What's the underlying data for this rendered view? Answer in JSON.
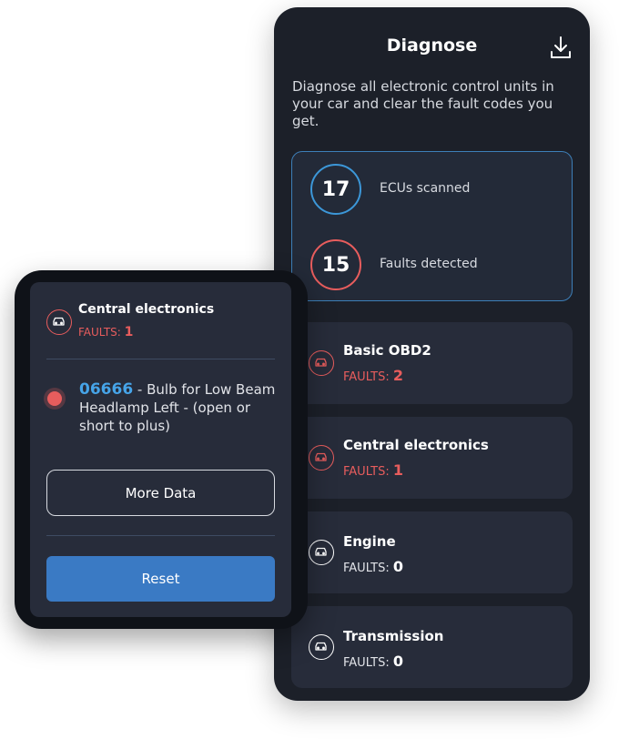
{
  "phone": {
    "title": "Diagnose",
    "description": "Diagnose all electronic control units in your car and clear the fault codes you get.",
    "stats": [
      {
        "value": "17",
        "label": "ECUs scanned"
      },
      {
        "value": "15",
        "label": "Faults detected"
      }
    ],
    "ecus": [
      {
        "name": "Basic OBD2",
        "faults_label": "FAULTS:",
        "faults": "2"
      },
      {
        "name": "Central electronics",
        "faults_label": "FAULTS:",
        "faults": "1"
      },
      {
        "name": "Engine",
        "faults_label": "FAULTS:",
        "faults": "0"
      },
      {
        "name": "Transmission",
        "faults_label": "FAULTS:",
        "faults": "0"
      }
    ]
  },
  "detail": {
    "title": "Central electronics",
    "faults_label": "FAULTS:",
    "faults": "1",
    "fault_code": "06666",
    "fault_description": " - Bulb for Low Beam Headlamp Left - (open or short to plus)",
    "more_data_label": "More Data",
    "reset_label": "Reset"
  },
  "colors": {
    "accent_blue": "#3c97d8",
    "fault_red": "#e85d5d",
    "button_blue": "#3a7ac4",
    "panel_bg": "#1c2029"
  },
  "icons": [
    "download-icon",
    "car-icon"
  ]
}
